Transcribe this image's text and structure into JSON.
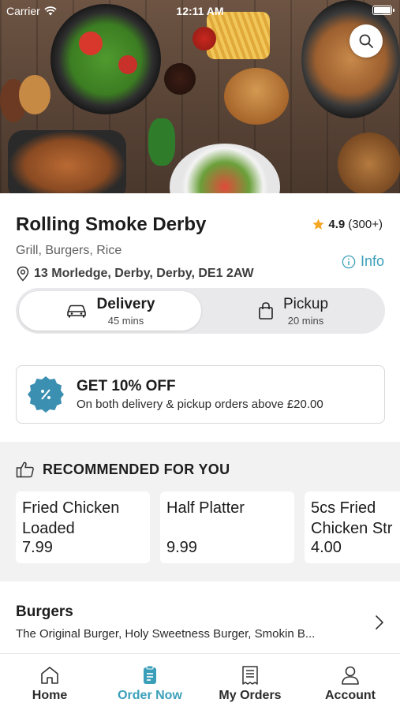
{
  "status_bar": {
    "carrier": "Carrier",
    "time": "12:11 AM"
  },
  "restaurant": {
    "name": "Rolling Smoke Derby",
    "cuisines": "Grill, Burgers, Rice",
    "address": "13 Morledge, Derby, Derby, DE1 2AW",
    "rating": "4.9",
    "rating_count": "(300+)",
    "info_label": "Info"
  },
  "order_mode": {
    "delivery": {
      "label": "Delivery",
      "time": "45 mins",
      "selected": true
    },
    "pickup": {
      "label": "Pickup",
      "time": "20 mins",
      "selected": false
    }
  },
  "offer": {
    "title": "GET 10% OFF",
    "description": "On both delivery & pickup orders above £20.00"
  },
  "recommended": {
    "title": "RECOMMENDED FOR YOU",
    "items": [
      {
        "name": "Fried Chicken\nLoaded",
        "price": "7.99"
      },
      {
        "name": "Half Platter",
        "price": "9.99"
      },
      {
        "name": "5cs Fried\nChicken Str",
        "price": "4.00"
      }
    ]
  },
  "category": {
    "title": "Burgers",
    "description": "The Original Burger, Holy Sweetness Burger, Smokin B..."
  },
  "tabs": [
    {
      "label": "Home",
      "icon": "home-icon",
      "active": false
    },
    {
      "label": "Order Now",
      "icon": "order-icon",
      "active": true
    },
    {
      "label": "My Orders",
      "icon": "receipt-icon",
      "active": false
    },
    {
      "label": "Account",
      "icon": "person-icon",
      "active": false
    }
  ],
  "colors": {
    "accent": "#3b9fba",
    "star": "#f5a623",
    "badge": "#3b8fb0"
  }
}
